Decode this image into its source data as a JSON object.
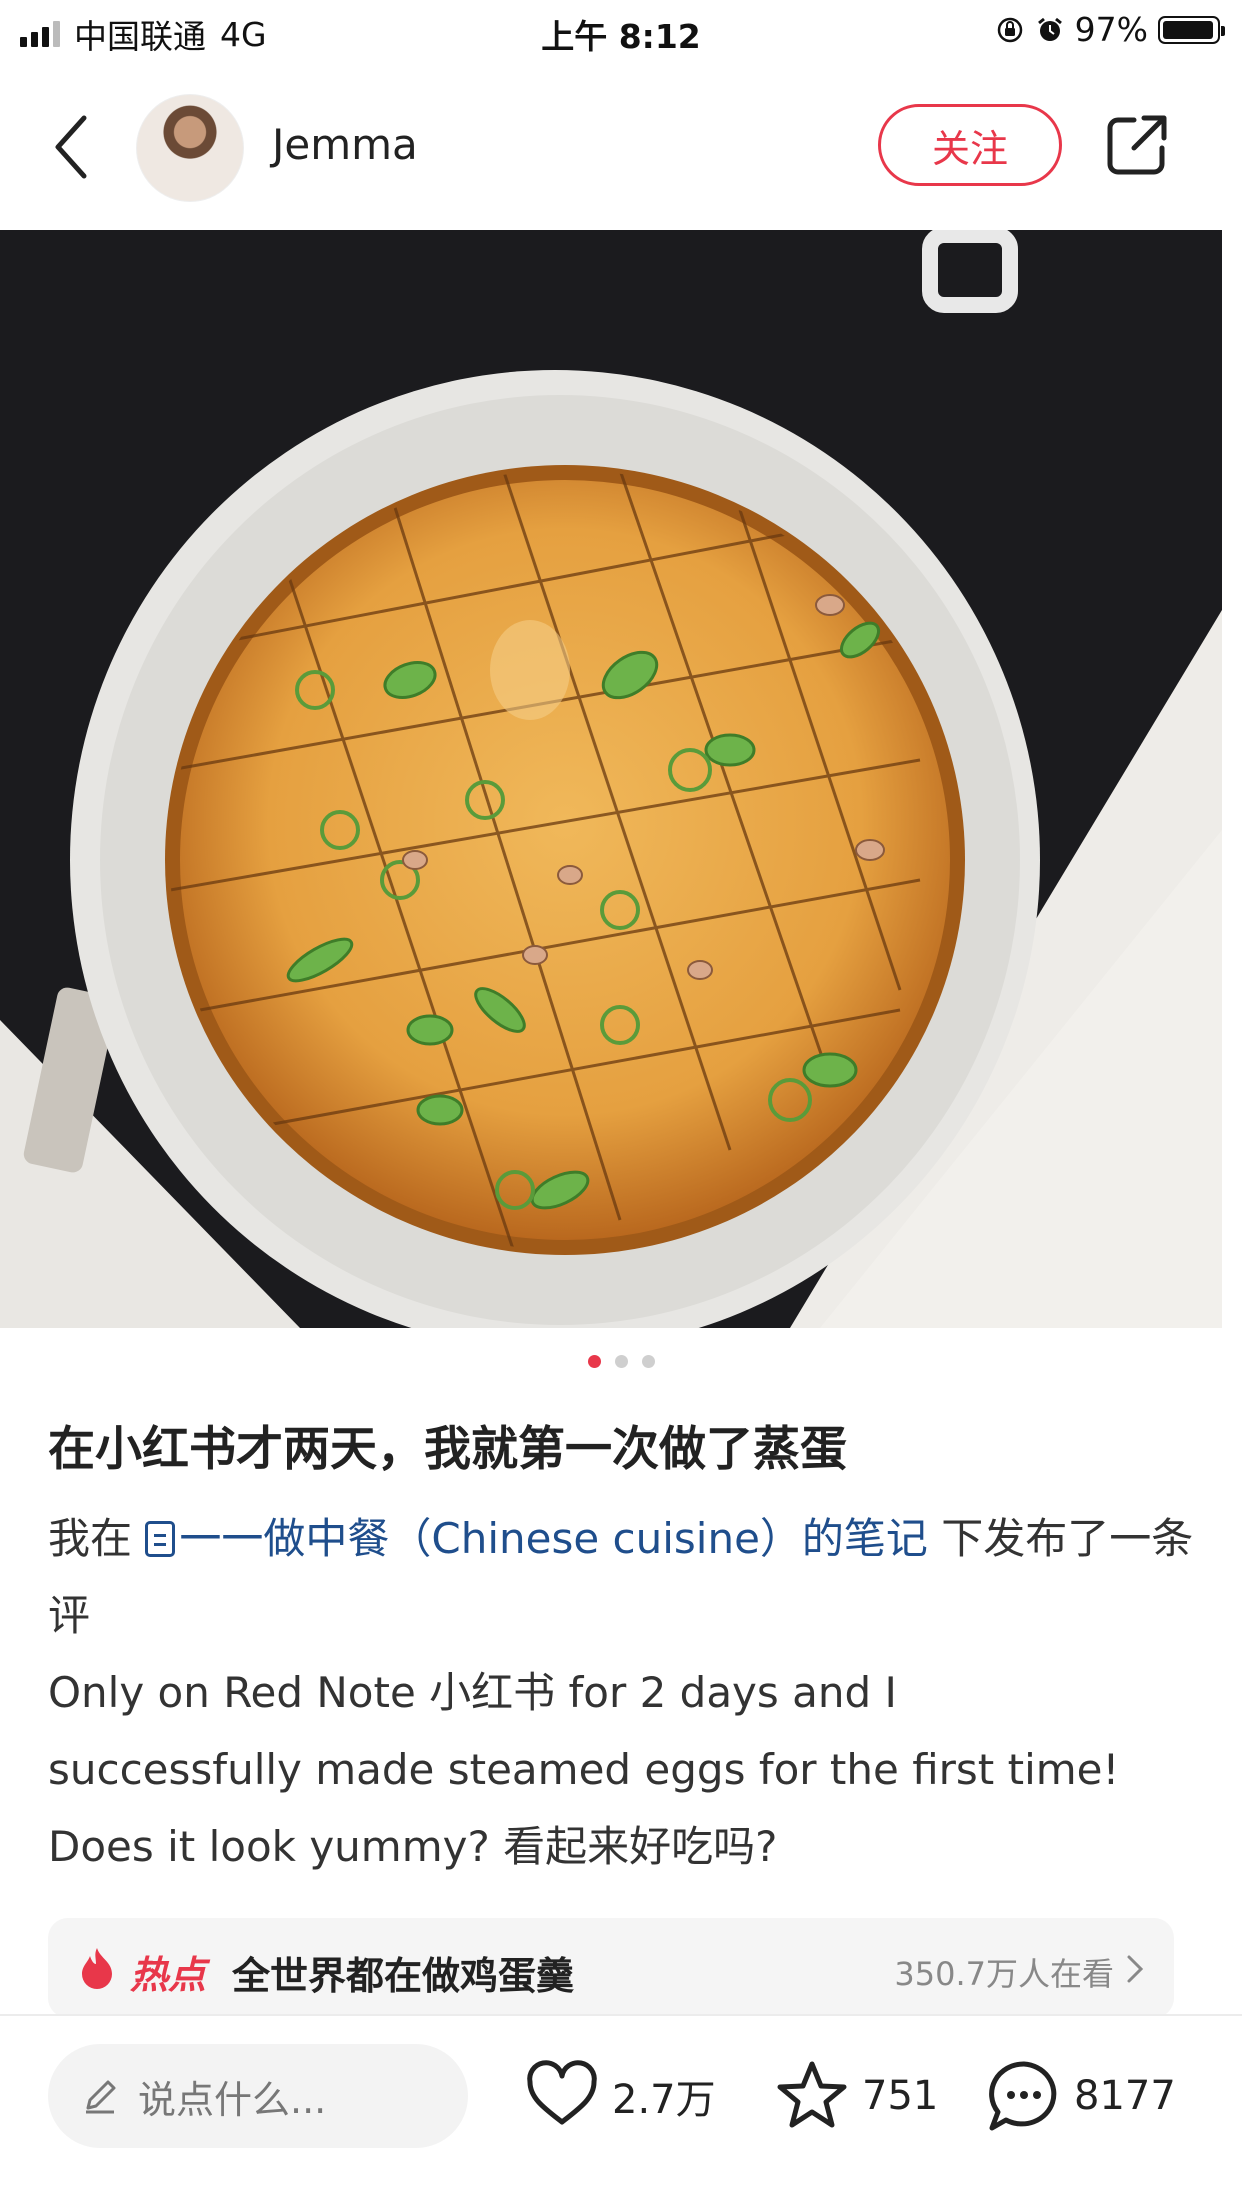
{
  "status_bar": {
    "carrier": "中国联通",
    "network": "4G",
    "time": "上午 8:12",
    "battery": "97%",
    "battery_level": 0.97
  },
  "header": {
    "username": "Jemma",
    "follow_label": "关注"
  },
  "carousel": {
    "total": 3,
    "active_index": 0
  },
  "post": {
    "title": "在小红书才两天，我就第一次做了蒸蛋",
    "intro_prefix": "我在",
    "link_text": "一一做中餐（Chinese cuisine）的笔记",
    "intro_suffix": "下发布了一条评",
    "body_lines": [
      "Only on Red Note 小红书 for 2 days and I",
      "successfully made steamed eggs for the first time!",
      "Does it look yummy? 看起来好吃吗?"
    ]
  },
  "hot_topic": {
    "tag": "热点",
    "title": "全世界都在做鸡蛋羹",
    "viewers": "350.7万人在看"
  },
  "bottom_bar": {
    "comment_placeholder": "说点什么...",
    "likes": "2.7万",
    "collects": "751",
    "comments": "8177"
  },
  "icons": {
    "back": "back-chevron-icon",
    "share": "share-icon",
    "like": "heart-icon",
    "collect": "star-icon",
    "comment": "comment-bubble-icon",
    "edit": "pencil-icon",
    "hot": "flame-icon"
  },
  "colors": {
    "accent": "#e8374a",
    "link": "#1f4e8c"
  }
}
